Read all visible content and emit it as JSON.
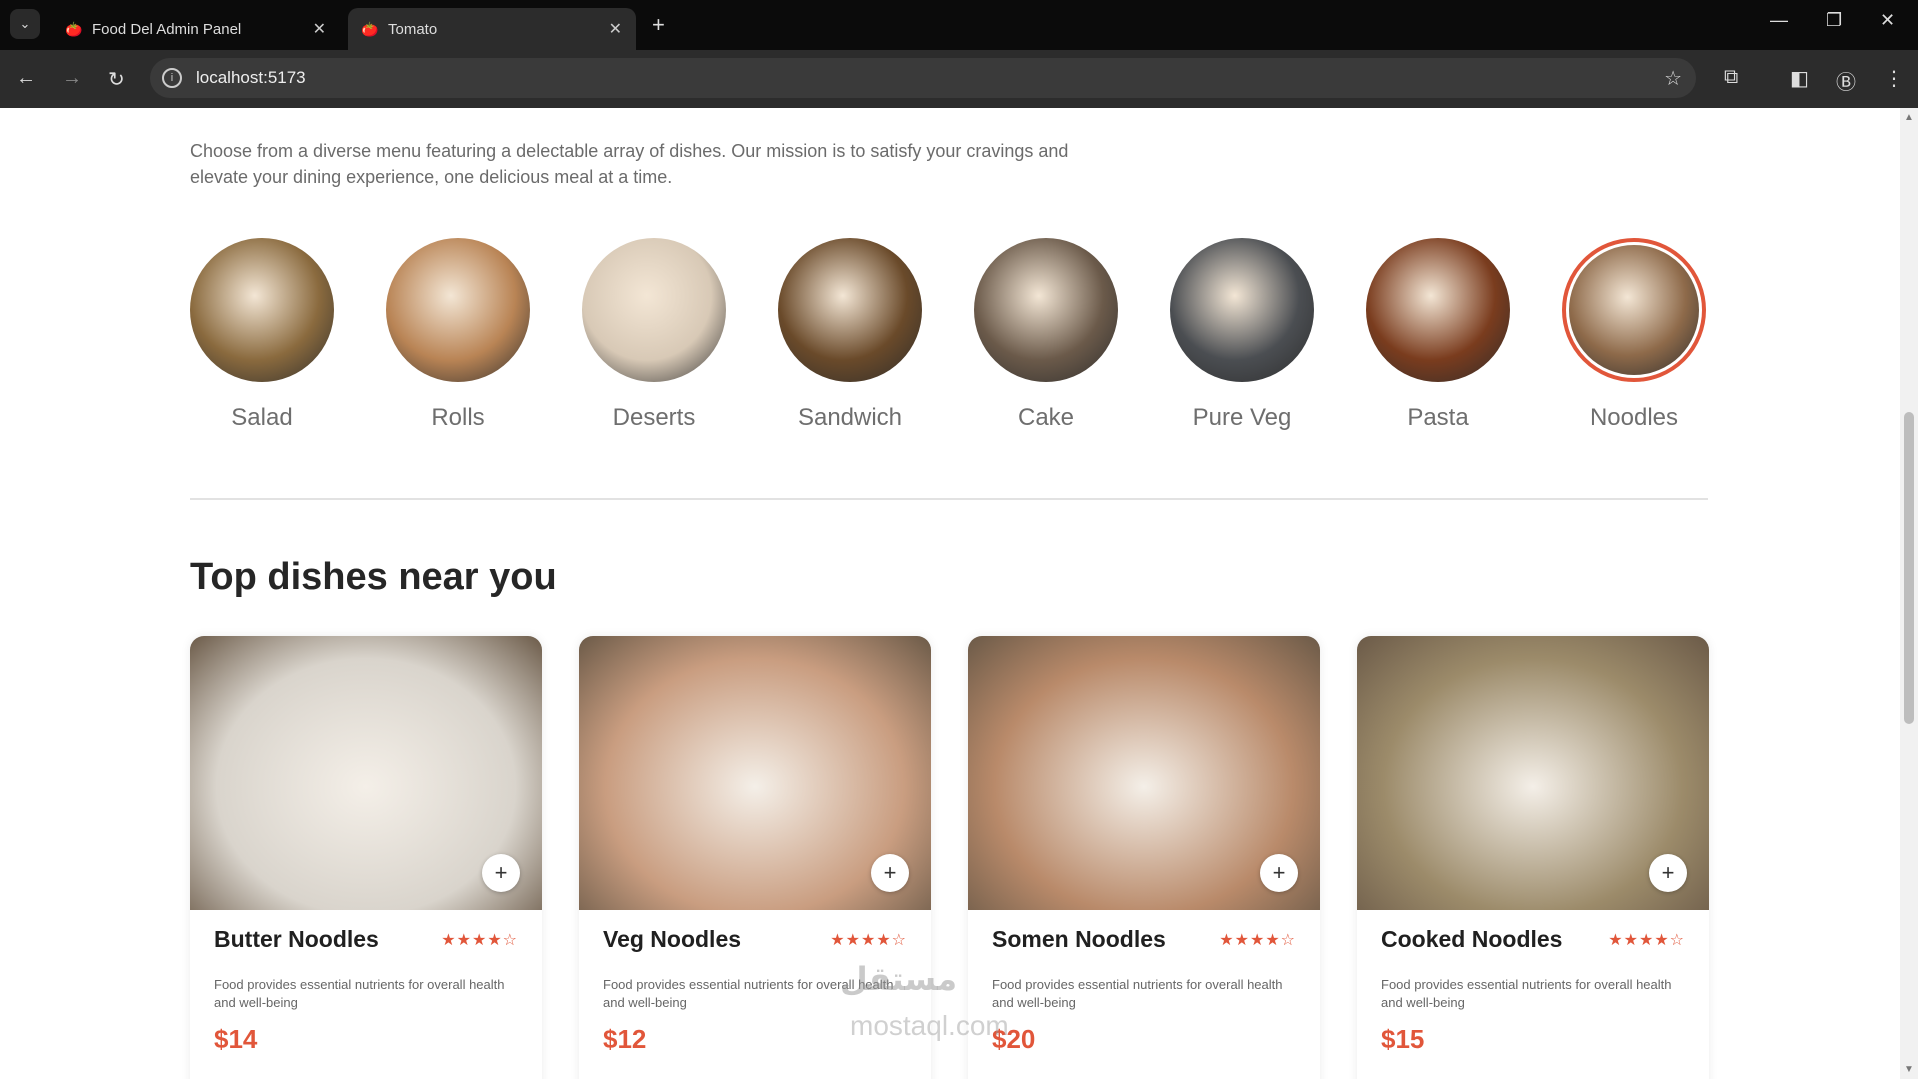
{
  "browser": {
    "tabs": [
      {
        "label": "Food Del Admin Panel"
      },
      {
        "label": "Tomato"
      }
    ],
    "url": "localhost:5173"
  },
  "menu": {
    "description": "Choose from a diverse menu featuring a delectable array of dishes. Our mission is to satisfy your cravings and elevate your dining experience, one delicious meal at a time.",
    "categories": [
      {
        "name": "Salad",
        "color": "#8a6a3e"
      },
      {
        "name": "Rolls",
        "color": "#b98455"
      },
      {
        "name": "Deserts",
        "color": "#d8c9b6"
      },
      {
        "name": "Sandwich",
        "color": "#6a4a2a"
      },
      {
        "name": "Cake",
        "color": "#6b5a4a"
      },
      {
        "name": "Pure Veg",
        "color": "#4b4e52"
      },
      {
        "name": "Pasta",
        "color": "#7a3c1e"
      },
      {
        "name": "Noodles",
        "color": "#8e6a4a"
      }
    ],
    "selected_index": 7
  },
  "dishes": {
    "heading": "Top dishes near you",
    "items": [
      {
        "name": "Butter Noodles",
        "rating": 4,
        "desc": "Food provides essential nutrients for overall health and well-being",
        "price": "$14",
        "color": "#d9d4cc"
      },
      {
        "name": "Veg Noodles",
        "rating": 4,
        "desc": "Food provides essential nutrients for overall health and well-being",
        "price": "$12",
        "color": "#c99d80"
      },
      {
        "name": "Somen Noodles",
        "rating": 4,
        "desc": "Food provides essential nutrients for overall health and well-being",
        "price": "$20",
        "color": "#b98a6a"
      },
      {
        "name": "Cooked Noodles",
        "rating": 4,
        "desc": "Food provides essential nutrients for overall health and well-being",
        "price": "$15",
        "color": "#9c8b6a"
      }
    ]
  },
  "watermark": {
    "arabic": "مستقل",
    "latin": "mostaql.com"
  },
  "icons": {
    "tab_favicon": "tomato-icon",
    "star_full": "★",
    "star_empty": "☆",
    "add": "+"
  }
}
